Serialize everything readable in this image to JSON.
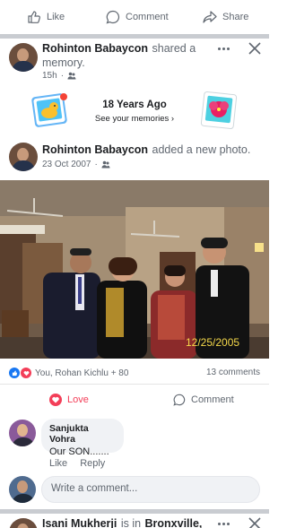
{
  "actions": {
    "like_label": "Like",
    "comment_label": "Comment",
    "share_label": "Share"
  },
  "memory_post": {
    "author": "Rohinton Babaycon",
    "action": "shared a memory.",
    "time": "15h",
    "card_title": "18 Years Ago",
    "card_link": "See your memories"
  },
  "photo_post": {
    "author": "Rohinton Babaycon",
    "action": "added a new photo.",
    "date": "23 Oct 2007",
    "photo_stamp": "12/25/2005"
  },
  "reactions": {
    "summary": "You, Rohan Kichlu + 80",
    "comments_count": "13 comments",
    "love_label": "Love",
    "comment_label": "Comment"
  },
  "comment": {
    "name": "Sanjukta Vohra",
    "text": "Our SON.......",
    "like_label": "Like",
    "reply_label": "Reply"
  },
  "write_comment": {
    "placeholder": "Write a comment..."
  },
  "next_post": {
    "author": "Isani Mukherji",
    "action": "is in",
    "place": "Bronxville,"
  },
  "colors": {
    "love": "#f33e58",
    "like": "#1877f2",
    "divider": "#c9ccd1",
    "meta": "#606770"
  }
}
